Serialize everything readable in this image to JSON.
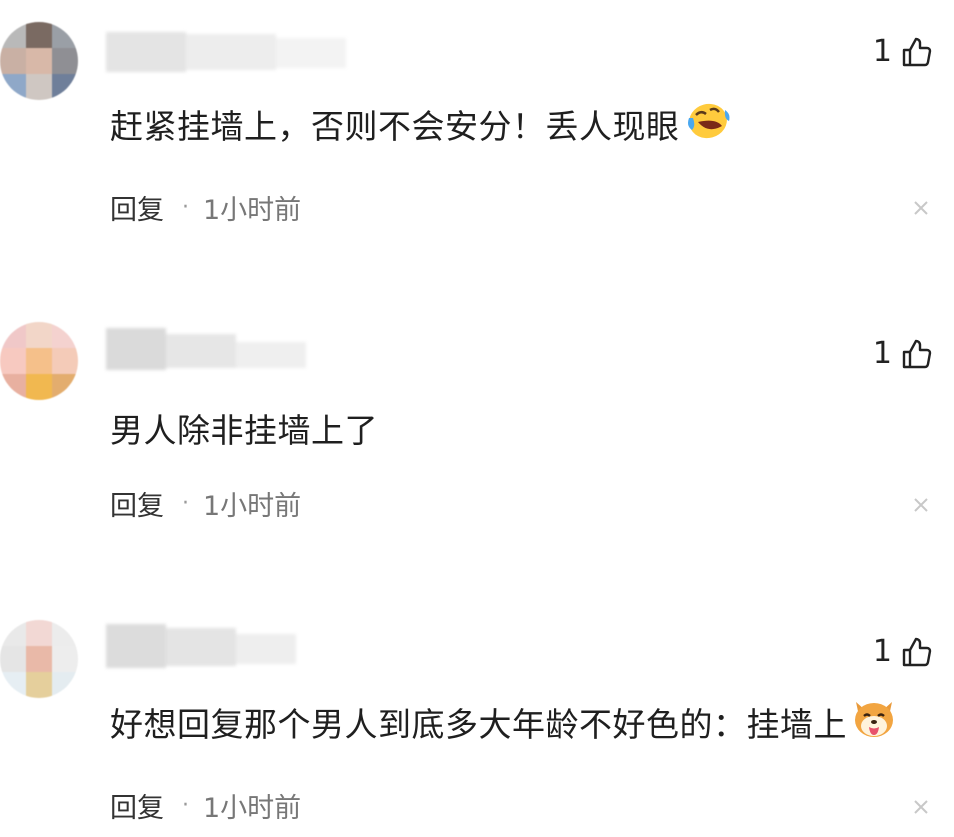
{
  "comments": [
    {
      "text": "赶紧挂墙上，否则不会安分！丢人现眼",
      "emoji": "laughing-crying-emoji",
      "likes": "1",
      "reply_label": "回复",
      "separator": "·",
      "time": "1小时前"
    },
    {
      "text": "男人除非挂墙上了",
      "emoji": "",
      "likes": "1",
      "reply_label": "回复",
      "separator": "·",
      "time": "1小时前"
    },
    {
      "text": "好想回复那个男人到底多大年龄不好色的：挂墙上",
      "emoji": "shiba-dog-emoji",
      "likes": "1",
      "reply_label": "回复",
      "separator": "·",
      "time": "1小时前"
    }
  ],
  "icons": {
    "like": "thumbs-up-icon",
    "dismiss": "close-icon"
  },
  "colors": {
    "text": "#1f1f1f",
    "meta": "#777777",
    "close": "#c8c8c8"
  }
}
